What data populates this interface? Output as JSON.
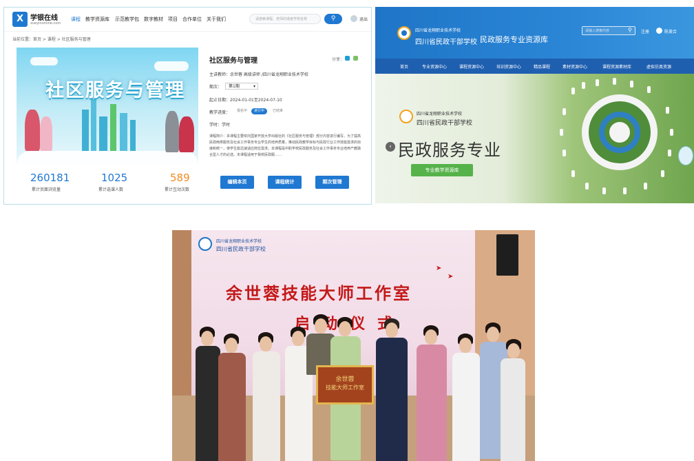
{
  "course_page": {
    "logo_text": "学银在线",
    "logo_sub": "xueyinonline.com",
    "nav": [
      "课程",
      "教学资源库",
      "示范教学包",
      "数字教材",
      "项目",
      "合作单位",
      "关于我们"
    ],
    "search_placeholder": "请搜索课程、老师的或者学校名称",
    "logout": "退出",
    "breadcrumb": "当前位置：首页 > 课程 > 社区服务与管理",
    "cover_title": "社区服务与管理",
    "title": "社区服务与管理",
    "share_label": "分享：",
    "lead_teacher": "主讲教师：余世蓉 高级讲师 /四川省龙翔职业技术学校",
    "term_label": "期次：",
    "term_value": "第1期",
    "dates": "起止日期：2024-01-01至2024-07-10",
    "progress_label": "教学进度：",
    "progress_states": [
      "报名中",
      "进行中",
      "已结束"
    ],
    "credits": "学时：学时",
    "description": "课程简介：本课程主要依托国家开放大学出版社的《社区服务与管理》部分内容进行编写。为了提高民政两类服务及社会工作事务专业学生的培养质量，推动民政教学目标与民政行业工作技能需求的衔接和统一，使学生能迅速适应岗位需求。本课程是中职学校民政服务及社会工作事务专业培养产教融合型人才的必选。本课程适用于我校民政服……",
    "stats": [
      {
        "value": "260181",
        "label": "累计页面浏览量"
      },
      {
        "value": "1025",
        "label": "累计选课人数"
      },
      {
        "value": "589",
        "label": "累计互动次数"
      }
    ],
    "buttons": [
      "编辑本页",
      "课程统计",
      "期次管理"
    ]
  },
  "resource_site": {
    "school_name_small": "四川省龙翔职业技术学校",
    "school_name": "四川省民政干部学校",
    "site_title": "民政服务专业资源库",
    "search_placeholder": "请输入搜索内容",
    "login": "注册",
    "user": "陈美合",
    "nav": [
      "首页",
      "专业资源中心",
      "课程资源中心",
      "培训资源中心",
      "精品课程",
      "素材资源中心",
      "课程资源素材库",
      "虚拟仿真资源"
    ],
    "banner_school_small": "四川省龙翔职业技术学校",
    "banner_school": "四川省民政干部学校",
    "banner_title": "民政服务专业",
    "banner_button": "专业教学资源库"
  },
  "photo": {
    "screen_school_small": "四川省龙翔职业技术学校",
    "screen_school": "四川省民政干部学校",
    "screen_title": "余世蓉技能大师工作室",
    "screen_subtitle": "启动仪式",
    "plaque_line1": "余世蓉",
    "plaque_line2": "技能大师工作室"
  },
  "colors": {
    "primary_blue": "#1f78d1",
    "accent_orange": "#f28a20",
    "green": "#56b24a",
    "banner_red": "#c31919"
  }
}
